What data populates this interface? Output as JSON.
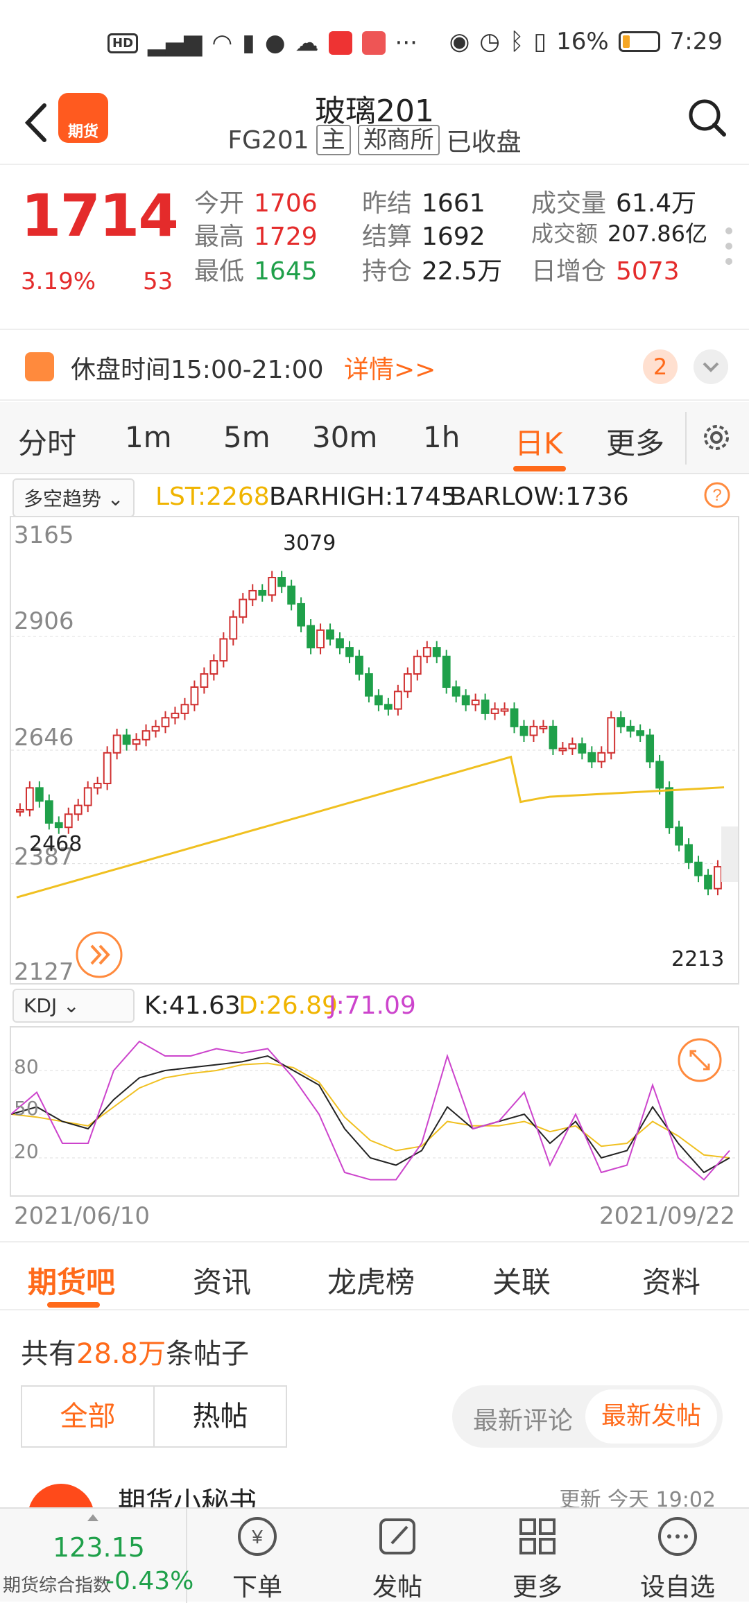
{
  "status_bar": {
    "battery": "16%",
    "time": "7:29",
    "left_icons": [
      "HD",
      "4G",
      "signal",
      "wifi",
      "alert",
      "chat",
      "cloud",
      "app",
      "book",
      "..."
    ],
    "right_icons": [
      "eye",
      "alarm",
      "bluetooth",
      "vibrate"
    ]
  },
  "header": {
    "title": "玻璃201",
    "code": "FG201",
    "tag_main": "主",
    "exchange": "郑商所",
    "status": "已收盘"
  },
  "quote": {
    "price": "1714",
    "change_pct": "3.19%",
    "change": "53",
    "fields": [
      {
        "label": "今开",
        "value": "1706",
        "color": "#e42b2b"
      },
      {
        "label": "昨结",
        "value": "1661",
        "color": "#222222"
      },
      {
        "label": "成交量",
        "value": "61.4万",
        "color": "#222222"
      },
      {
        "label": "最高",
        "value": "1729",
        "color": "#e42b2b"
      },
      {
        "label": "结算",
        "value": "1692",
        "color": "#222222"
      },
      {
        "label": "成交额",
        "value": "207.86亿",
        "color": "#222222"
      },
      {
        "label": "最低",
        "value": "1645",
        "color": "#1fa04a"
      },
      {
        "label": "持仓",
        "value": "22.5万",
        "color": "#222222"
      },
      {
        "label": "日增仓",
        "value": "5073",
        "color": "#e42b2b"
      }
    ]
  },
  "notice": {
    "text": "休盘时间15:00-21:00",
    "link": "详情>>",
    "badge": "2"
  },
  "periods": [
    "分时",
    "1m",
    "5m",
    "30m",
    "1h",
    "日K",
    "更多"
  ],
  "active_period": "日K",
  "indicator": {
    "name": "多空趋势",
    "lst": "LST:2268",
    "barhigh": "BARHIGH:1745",
    "barlow": "BARLOW:1736"
  },
  "kdj": {
    "name": "KDJ",
    "k": "K:41.63",
    "d": "D:26.89",
    "j": "J:71.09"
  },
  "chart_data": [
    {
      "type": "candlestick",
      "y_ticks": [
        "3165",
        "2906",
        "2646",
        "2387",
        "2127"
      ],
      "ylim": [
        2127,
        3165
      ],
      "annotations": {
        "max": "3079",
        "min_left": "2468",
        "min_right": "2213"
      },
      "series": [
        {
          "name": "MA (yellow)",
          "color": "#f0c020"
        },
        {
          "name": "trend (red/green steps)",
          "color": "#d03030"
        }
      ]
    },
    {
      "type": "line",
      "y_ticks": [
        "80",
        "50",
        "20"
      ],
      "series": [
        {
          "name": "K",
          "color": "#222222"
        },
        {
          "name": "D",
          "color": "#f0c020"
        },
        {
          "name": "J",
          "color": "#cc44cc"
        }
      ]
    }
  ],
  "dates": {
    "start": "2021/06/10",
    "end": "2021/09/22"
  },
  "content_tabs": [
    "期货吧",
    "资讯",
    "龙虎榜",
    "关联",
    "资料"
  ],
  "posts": {
    "count_prefix": "共有",
    "count": "28.8万",
    "count_suffix": "条帖子",
    "filter_all": "全部",
    "filter_hot": "热帖",
    "sort_comment": "最新评论",
    "sort_post": "最新发帖"
  },
  "post_item": {
    "author": "期货小秘书",
    "time": "更新 今天 19:02"
  },
  "bottom": {
    "index_value": "123.15",
    "index_label": "期货综合指数",
    "index_change": "-0.43%",
    "nav": [
      "下单",
      "发帖",
      "更多",
      "设自选"
    ]
  }
}
